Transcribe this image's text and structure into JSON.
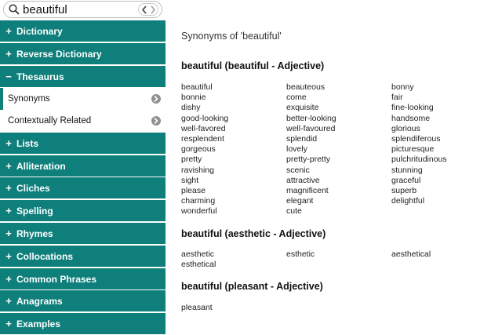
{
  "search": {
    "value": "beautiful"
  },
  "sidebar": {
    "items": [
      {
        "sign": "+",
        "label": "Dictionary"
      },
      {
        "sign": "+",
        "label": "Reverse Dictionary"
      },
      {
        "sign": "−",
        "label": "Thesaurus"
      },
      {
        "label": "Synonyms"
      },
      {
        "label": "Contextually Related"
      },
      {
        "sign": "+",
        "label": "Lists"
      },
      {
        "sign": "+",
        "label": "Alliteration"
      },
      {
        "sign": "+",
        "label": "Cliches"
      },
      {
        "sign": "+",
        "label": "Spelling"
      },
      {
        "sign": "+",
        "label": "Rhymes"
      },
      {
        "sign": "+",
        "label": "Collocations"
      },
      {
        "sign": "+",
        "label": "Common Phrases"
      },
      {
        "sign": "+",
        "label": "Anagrams"
      },
      {
        "sign": "+",
        "label": "Examples"
      }
    ]
  },
  "main": {
    "title": "Synonyms of 'beautiful'",
    "sections": [
      {
        "heading": "beautiful (beautiful - Adjective)",
        "columns": [
          [
            "beautiful",
            "bonnie",
            "dishy",
            "good-looking",
            "well-favored",
            "resplendent",
            "gorgeous",
            "pretty",
            "ravishing",
            "sight",
            "please",
            "charming",
            "wonderful"
          ],
          [
            "beauteous",
            "come",
            "exquisite",
            "better-looking",
            "well-favoured",
            "splendid",
            "lovely",
            "pretty-pretty",
            "scenic",
            "attractive",
            "magnificent",
            "elegant",
            "cute"
          ],
          [
            "bonny",
            "fair",
            "fine-looking",
            "handsome",
            "glorious",
            "splendiferous",
            "picturesque",
            "pulchritudinous",
            "stunning",
            "graceful",
            "superb",
            "delightful"
          ]
        ]
      },
      {
        "heading": "beautiful (aesthetic - Adjective)",
        "columns": [
          [
            "aesthetic",
            "esthetical"
          ],
          [
            "esthetic"
          ],
          [
            "aesthetical"
          ]
        ]
      },
      {
        "heading": "beautiful (pleasant - Adjective)",
        "columns": [
          [
            "pleasant"
          ],
          [],
          []
        ]
      }
    ]
  },
  "colors": {
    "sidebar_accent": "#0e7f7b"
  },
  "icons": {
    "search": "magnifier-icon",
    "prev": "chevron-left-icon",
    "next": "chevron-right-icon",
    "submenu": "chevron-right-circle-icon"
  }
}
